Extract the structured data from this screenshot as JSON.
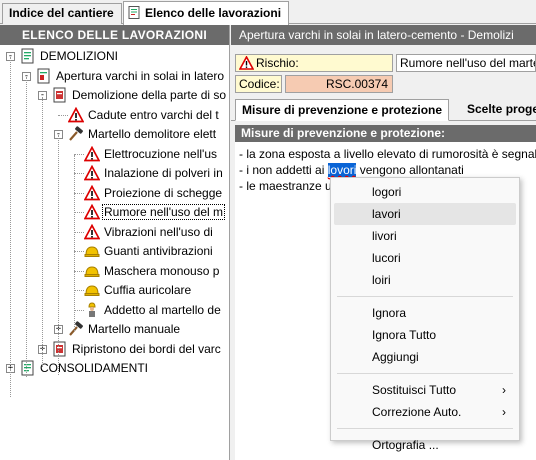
{
  "tabs": [
    {
      "label": "Indice del cantiere",
      "active": false
    },
    {
      "label": "Elenco delle lavorazioni",
      "active": true
    }
  ],
  "left_panel": {
    "title": "ELENCO DELLE LAVORAZIONI",
    "tree": [
      {
        "label": "DEMOLIZIONI",
        "icon": "folder-doc-icon",
        "expander": "-"
      },
      {
        "label": "Apertura varchi in solai in latero",
        "icon": "task-doc-icon",
        "expander": "-"
      },
      {
        "label": "Demolizione della parte di so",
        "icon": "phase-doc-icon",
        "expander": "-"
      },
      {
        "label": "Cadute entro varchi  del t",
        "icon": "warning-icon"
      },
      {
        "label": "Martello demolitore elett",
        "icon": "hammer-icon",
        "expander": "-"
      },
      {
        "label": "Elettrocuzione nell'us",
        "icon": "warning-icon"
      },
      {
        "label": "Inalazione di polveri in",
        "icon": "warning-icon"
      },
      {
        "label": "Proiezione di schegge",
        "icon": "warning-icon"
      },
      {
        "label": "Rumore nell'uso del m",
        "icon": "warning-icon",
        "selected": true
      },
      {
        "label": "Vibrazioni nell'uso di",
        "icon": "warning-icon"
      },
      {
        "label": "Guanti antivibrazioni",
        "icon": "helmet-icon"
      },
      {
        "label": "Maschera monouso p",
        "icon": "helmet-icon"
      },
      {
        "label": "Cuffia auricolare",
        "icon": "helmet-icon"
      },
      {
        "label": "Addetto al martello de",
        "icon": "worker-icon"
      },
      {
        "label": "Martello manuale",
        "icon": "hammer-icon",
        "expander": "+"
      },
      {
        "label": "Ripristono dei bordi del varc",
        "icon": "phase-doc-icon",
        "expander": "+"
      },
      {
        "label": "CONSOLIDAMENTI",
        "icon": "folder-doc-icon",
        "expander": "+"
      }
    ]
  },
  "right_panel": {
    "title": "Apertura varchi in solai in latero-cemento - Demolizi",
    "rischio_label": "Rischio:",
    "rischio_value": "Rumore nell'uso del martello e",
    "codice_label": "Codice:",
    "codice_value": "RSC.00374",
    "subtabs": [
      "Misure di prevenzione e protezione",
      "Scelte proge"
    ],
    "section_title": "Misure di prevenzione e protezione:",
    "text_lines": [
      {
        "before": "- la zona esposta a livello elevato di rumorosità è segnala",
        "word": "",
        "after": ""
      },
      {
        "before": "- i non addetti ai ",
        "word": "lovori",
        "after": " vengono allontanati"
      },
      {
        "before": "- le maestranze u",
        "word": "",
        "after": ""
      }
    ]
  },
  "context_menu": {
    "suggestions": [
      "logori",
      "lavori",
      "livori",
      "lucori",
      "loiri"
    ],
    "hovered": "lavori",
    "actions": [
      "Ignora",
      "Ignora Tutto",
      "Aggiungi"
    ],
    "submenus": [
      "Sostituisci Tutto",
      "Correzione Auto."
    ],
    "tools": [
      "Ortografia ..."
    ]
  },
  "colors": {
    "header_bg": "#6b6b6b",
    "rischio_bg": "#fffad0",
    "codice_bg": "#f6cbb2",
    "selection_blue": "#0a64d6"
  }
}
